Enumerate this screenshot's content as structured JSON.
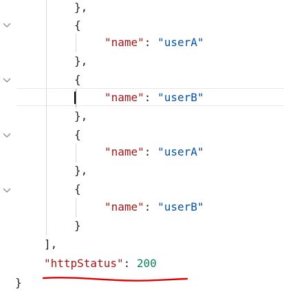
{
  "editor": {
    "lines": [
      {
        "brace": "},"
      },
      {
        "brace": "{"
      },
      {
        "key": "\"name\"",
        "sep": ": ",
        "val": "\"userA\""
      },
      {
        "brace": "},"
      },
      {
        "brace": "{"
      },
      {
        "key": "\"name\"",
        "sep": ": ",
        "val": "\"userB\""
      },
      {
        "brace": "},"
      },
      {
        "brace": "{"
      },
      {
        "key": "\"name\"",
        "sep": ": ",
        "val": "\"userA\""
      },
      {
        "brace": "},"
      },
      {
        "brace": "{"
      },
      {
        "key": "\"name\"",
        "sep": ": ",
        "val": "\"userB\""
      },
      {
        "brace": "}"
      },
      {
        "brace": "],"
      },
      {
        "key": "\"httpStatus\"",
        "sep": ": ",
        "val": "200"
      },
      {
        "brace": "}"
      }
    ],
    "fold_icon": "chevron-down-icon",
    "annotation_color": "#e00000"
  }
}
